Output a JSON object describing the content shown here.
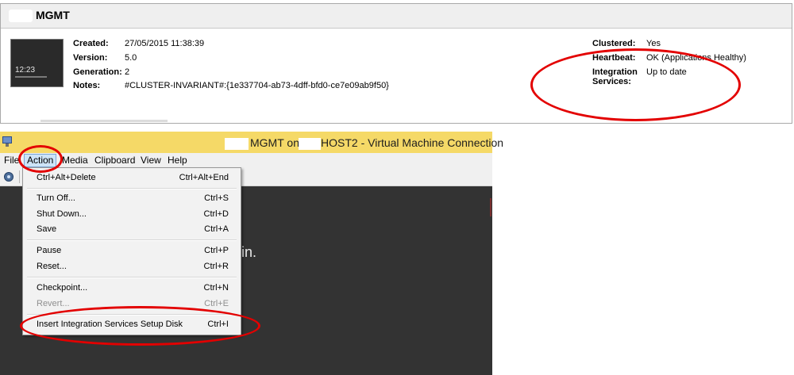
{
  "details": {
    "title": "MGMT",
    "thumbnail_time": "12:23",
    "left": [
      {
        "label": "Created:",
        "value": "27/05/2015 11:38:39"
      },
      {
        "label": "Version:",
        "value": "5.0"
      },
      {
        "label": "Generation:",
        "value": "2"
      },
      {
        "label": "Notes:",
        "value": "#CLUSTER-INVARIANT#:{1e337704-ab73-4dff-bfd0-ce7e09ab9f50}"
      }
    ],
    "right": [
      {
        "label": "Clustered:",
        "value": "Yes"
      },
      {
        "label": "Heartbeat:",
        "value": "OK (Applications Healthy)"
      },
      {
        "label": "Integration Services:",
        "value": "Up to date"
      }
    ]
  },
  "vm_window": {
    "title_part1": "MGMT on",
    "title_part2": "HOST2 - Virtual Machine Connection",
    "menus": [
      "File",
      "Action",
      "Media",
      "Clipboard",
      "View",
      "Help"
    ],
    "screen_text": "in."
  },
  "action_menu": {
    "items": [
      {
        "label": "Ctrl+Alt+Delete",
        "shortcut": "Ctrl+Alt+End"
      },
      {
        "label": "Turn Off...",
        "shortcut": "Ctrl+S"
      },
      {
        "label": "Shut Down...",
        "shortcut": "Ctrl+D"
      },
      {
        "label": "Save",
        "shortcut": "Ctrl+A"
      },
      {
        "label": "Pause",
        "shortcut": "Ctrl+P"
      },
      {
        "label": "Reset...",
        "shortcut": "Ctrl+R"
      },
      {
        "label": "Checkpoint...",
        "shortcut": "Ctrl+N"
      },
      {
        "label": "Revert...",
        "shortcut": "Ctrl+E",
        "disabled": true
      },
      {
        "label": "Insert Integration Services Setup Disk",
        "shortcut": "Ctrl+I"
      }
    ]
  },
  "colors": {
    "titlebar": "#f5d967",
    "annotation": "#e30000",
    "vm_screen": "#333333"
  }
}
